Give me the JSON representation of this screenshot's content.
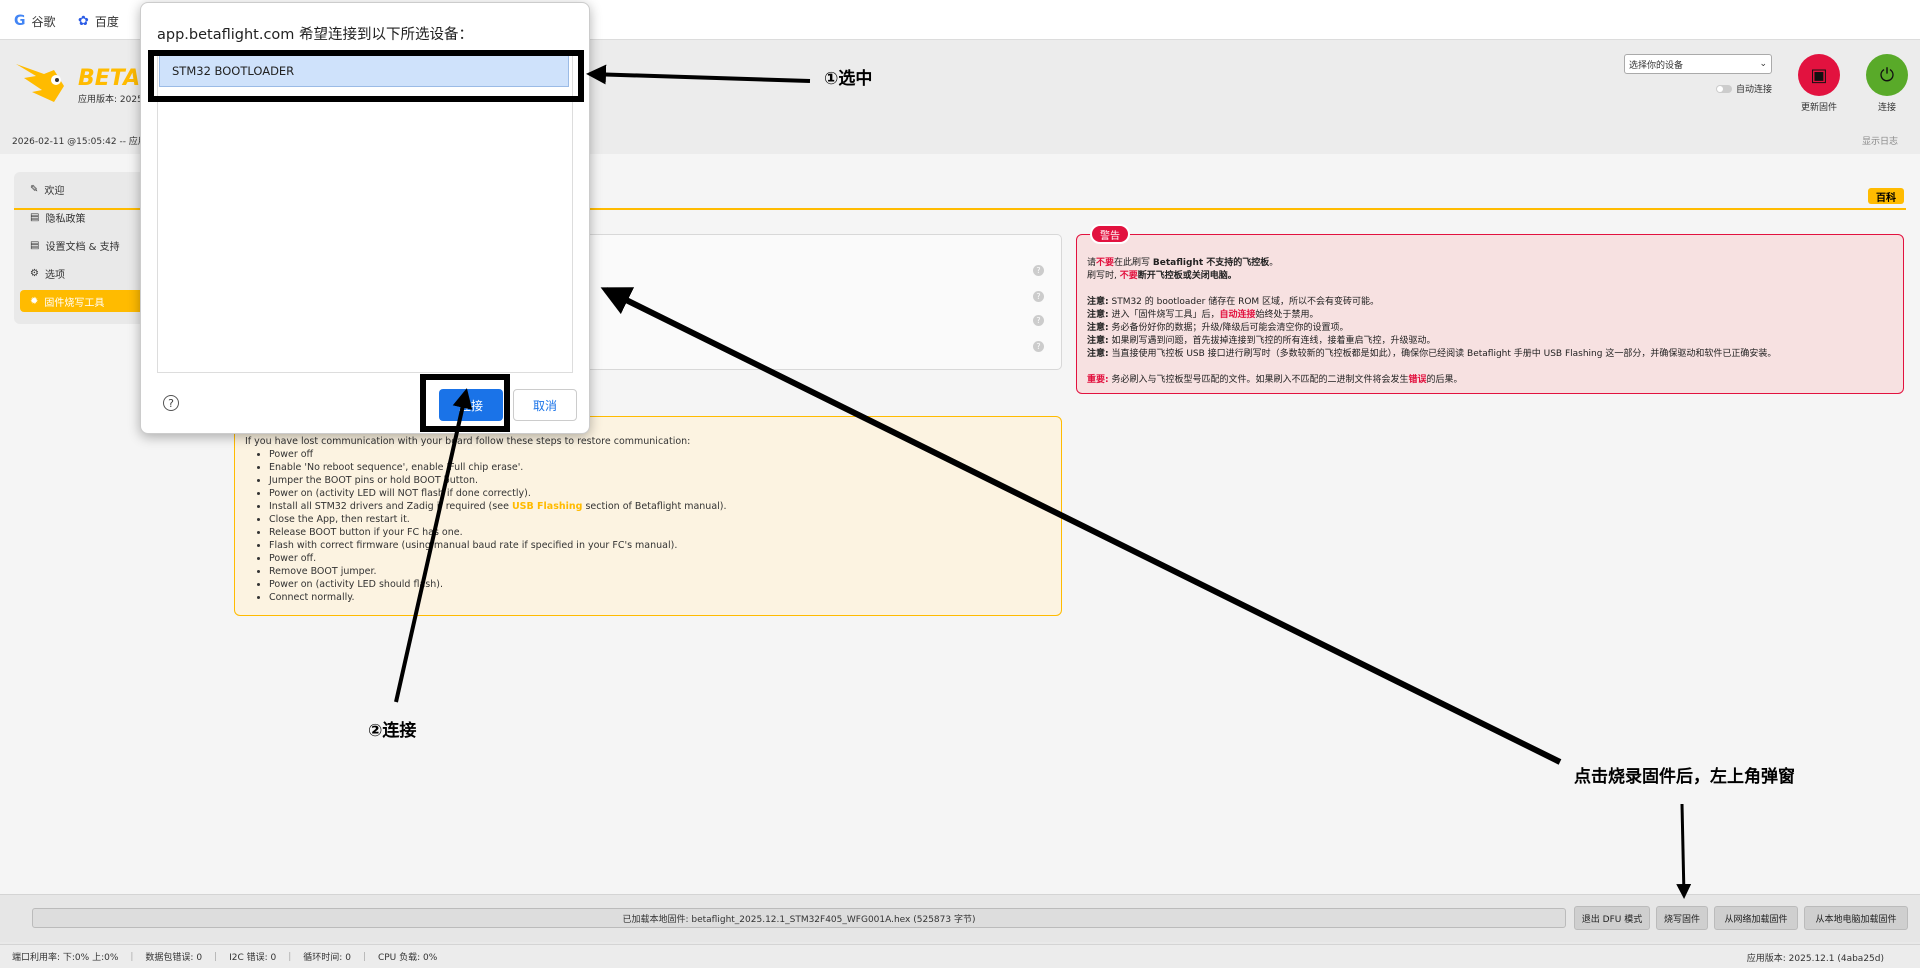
{
  "browser": {
    "bookmarks": [
      {
        "label": "谷歌",
        "icon": "google-icon"
      },
      {
        "label": "百度",
        "icon": "baidu-paw-icon"
      }
    ]
  },
  "header": {
    "logo_text": "BETA",
    "version_label": "应用版本: 2025",
    "device_select_value": "选择你的设备",
    "auto_connect_label": "自动连接",
    "update_firmware_label": "更新固件",
    "connect_label": "连接",
    "datetime": "2026-02-11 @15:05:42 -- 应用",
    "show_log": "显示日志",
    "accent_color": "#ffbb00"
  },
  "sidebar": {
    "items": [
      {
        "label": "欢迎",
        "icon": "wrench-icon"
      },
      {
        "label": "隐私政策",
        "icon": "document-icon"
      },
      {
        "label": "设置文档 & 支持",
        "icon": "document-icon"
      },
      {
        "label": "选项",
        "icon": "gear-icon"
      },
      {
        "label": "固件烧写工具",
        "icon": "flash-icon",
        "active": true
      }
    ]
  },
  "main": {
    "wiki_badge": "百科",
    "warning": {
      "badge": "警告",
      "line1_a": "请",
      "line1_b": "不要",
      "line1_c": "在此刷写 ",
      "line1_d": "Betaflight 不支持的飞控板",
      "line1_e": "。",
      "line2_a": "刷写时, ",
      "line2_b": "不要",
      "line2_c": "断开飞控板或关闭电脑。",
      "notes_label": "注意:",
      "notes": [
        "STM32 的 bootloader 储存在 ROM 区域，所以不会有变砖可能。",
        "进入「固件烧写工具」后，",
        "务必备份好你的数据；升级/降级后可能会清空你的设置项。",
        "如果刷写遇到问题，首先拔掉连接到飞控的所有连线，接着重启飞控，升级驱动。",
        "当直接使用飞控板 USB 接口进行刷写时（多数较新的飞控板都是如此），确保你已经阅读 Betaflight 手册中 USB Flashing 这一部分，并确保驱动和软件已正确安装。"
      ],
      "note2_red": "自动连接",
      "note2_tail": "始终处于禁用。",
      "important_label": "重要:",
      "important_text": "务必刷入与飞控板型号匹配的文件。如果刷入不匹配的二进制文件将会发生",
      "important_red": "错误",
      "important_tail": "的后果。"
    },
    "recovery": {
      "intro": "If you have lost communication with your board follow these steps to restore communication:",
      "steps": [
        "Power off",
        "Enable 'No reboot sequence', enable 'Full chip erase'.",
        "Jumper the BOOT pins or hold BOOT button.",
        "Power on (activity LED will NOT flash if done correctly).",
        "Install all STM32 drivers and Zadig if required (see ",
        "Close the App, then restart it.",
        "Release BOOT button if your FC has one.",
        "Flash with correct firmware (using manual baud rate if specified in your FC's manual).",
        "Power off.",
        "Remove BOOT jumper.",
        "Power on (activity LED should flash).",
        "Connect normally."
      ],
      "link_text": "USB Flashing",
      "link_tail": " section of Betaflight manual)."
    }
  },
  "footer": {
    "progress_text": "已加载本地固件: betaflight_2025.12.1_STM32F405_WFG001A.hex (525873 字节)",
    "buttons": [
      "退出 DFU 模式",
      "烧写固件",
      "从网络加载固件",
      "从本地电脑加载固件"
    ],
    "status": [
      "端口利用率: 下:0% 上:0%",
      "数据包错误: 0",
      "I2C 错误: 0",
      "循环时间: 0",
      "CPU 负载: 0%"
    ],
    "app_version": "应用版本: 2025.12.1 (4aba25d)"
  },
  "chooser": {
    "title": "app.betaflight.com 希望连接到以下所选设备：",
    "device": "STM32  BOOTLOADER",
    "help": "?",
    "connect": "连接",
    "cancel": "取消",
    "button_color": "#1a73e8"
  },
  "annotations": {
    "select": "①选中",
    "connect": "②连接",
    "popup": "点击烧录固件后，左上角弹窗"
  }
}
